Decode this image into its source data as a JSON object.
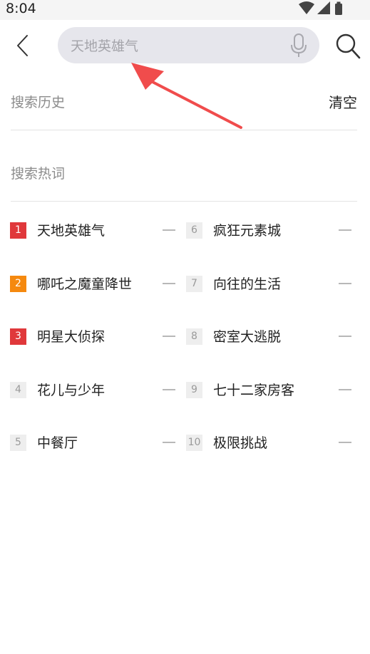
{
  "status_bar": {
    "time": "8:04"
  },
  "search": {
    "placeholder": "天地英雄气",
    "value": ""
  },
  "history": {
    "title": "搜索历史",
    "clear_label": "清空"
  },
  "hot": {
    "title": "搜索热词",
    "left_column": [
      {
        "rank": "1",
        "label": "天地英雄气",
        "badge": "red"
      },
      {
        "rank": "2",
        "label": "哪吒之魔童降世",
        "badge": "orange"
      },
      {
        "rank": "3",
        "label": "明星大侦探",
        "badge": "red"
      },
      {
        "rank": "4",
        "label": "花儿与少年",
        "badge": "gray"
      },
      {
        "rank": "5",
        "label": "中餐厅",
        "badge": "gray"
      }
    ],
    "right_column": [
      {
        "rank": "6",
        "label": "疯狂元素城",
        "badge": "gray"
      },
      {
        "rank": "7",
        "label": "向往的生活",
        "badge": "gray"
      },
      {
        "rank": "8",
        "label": "密室大逃脱",
        "badge": "gray"
      },
      {
        "rank": "9",
        "label": "七十二家房客",
        "badge": "gray"
      },
      {
        "rank": "10",
        "label": "极限挑战",
        "badge": "gray"
      }
    ],
    "trend": "—"
  },
  "colors": {
    "badge_red": "#e0383b",
    "badge_orange": "#f5890f",
    "badge_gray_bg": "#eeeeee",
    "badge_gray_text": "#9a9a9a",
    "annotation_arrow": "#f04c4c"
  },
  "icons": [
    "wifi-icon",
    "signal-icon",
    "battery-icon",
    "back-arrow-icon",
    "microphone-icon",
    "search-icon"
  ]
}
